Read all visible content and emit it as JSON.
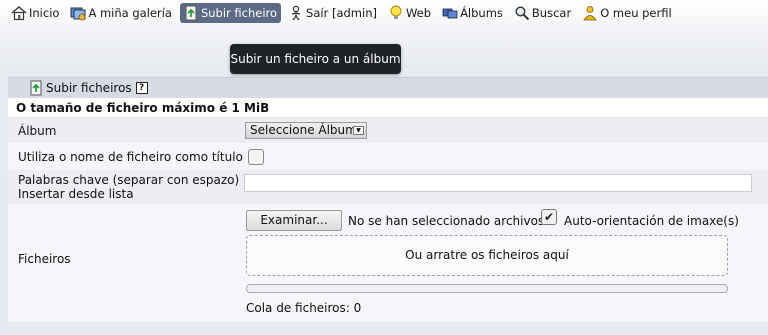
{
  "nav": {
    "items": [
      {
        "label": "Inicio",
        "icon": "home-icon"
      },
      {
        "label": "A miña galería",
        "icon": "gallery-icon"
      },
      {
        "label": "Subir ficheiro",
        "icon": "upload-icon",
        "active": true
      },
      {
        "label": "Saír [admin]",
        "icon": "logout-icon"
      },
      {
        "label": "Web",
        "icon": "bulb-icon"
      },
      {
        "label": "Álbums",
        "icon": "albums-icon"
      },
      {
        "label": "Buscar",
        "icon": "search-icon"
      },
      {
        "label": "O meu perfil",
        "icon": "profile-icon"
      }
    ]
  },
  "tooltip": "Subir un ficheiro a un álbum",
  "panel": {
    "title": "Subir ficheiros",
    "help": "?",
    "max_size": "O tamaño de ficheiro máximo é 1 MiB",
    "album_label": "Álbum",
    "album_select": "Seleccione Álbum",
    "filename_title_label": "Utiliza o nome de ficheiro como título",
    "keywords_label": "Palabras chave (separar con espazo)",
    "keywords_link": "Insertar desde lista",
    "keywords_value": "",
    "files_label": "Ficheiros",
    "browse_button": "Examinar...",
    "no_file_text": "No se han seleccionado archivos.",
    "auto_orient_label": "Auto-orientación de imaxe(s)",
    "auto_orient_checked": true,
    "dropzone_text": "Ou arratre os ficheiros aquí",
    "upload_progress": 0,
    "queue_text": "Cola de ficheiros: 0"
  },
  "colors": {
    "active_nav_bg": "#5d6a86",
    "header_bg": "#d5dae3",
    "link": "#2b3f8c",
    "tooltip_bg": "#1f2328"
  }
}
